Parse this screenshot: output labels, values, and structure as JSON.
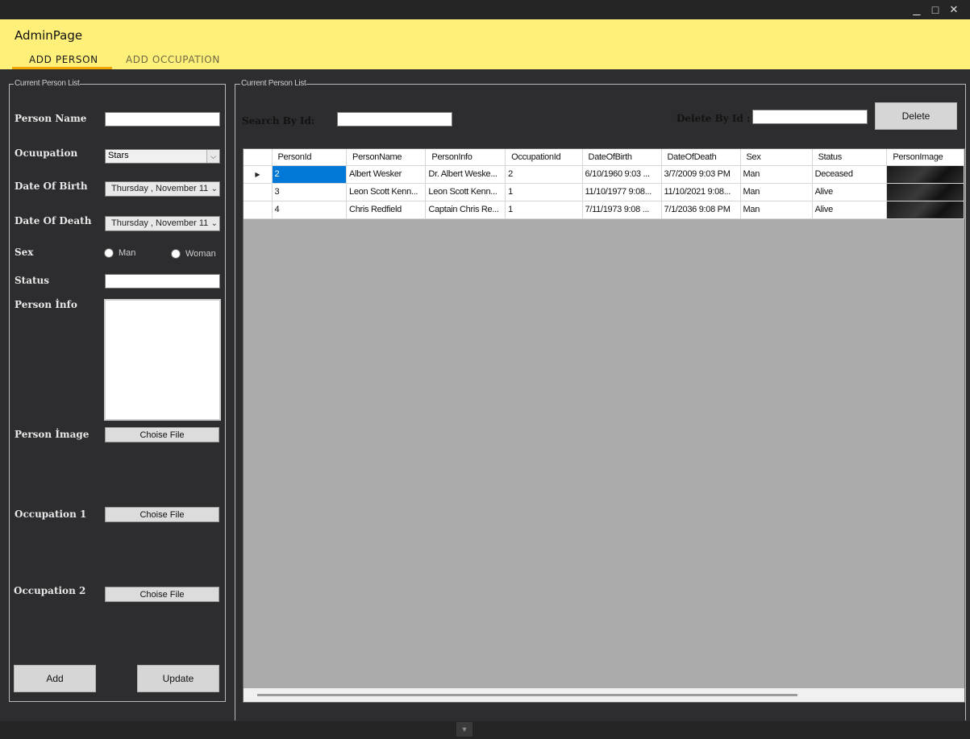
{
  "window": {
    "minimize_glyph": "_",
    "maximize_glyph": "□",
    "close_glyph": "✕"
  },
  "app": {
    "title": "AdminPage",
    "tabs": [
      {
        "label": "ADD PERSON",
        "active": true
      },
      {
        "label": "ADD OCCUPATION",
        "active": false
      }
    ],
    "accent_color": "#fff07a",
    "tab_indicator_color": "#f2a800"
  },
  "form": {
    "group_title": "Current Person List",
    "labels": {
      "person_name": "Person Name",
      "occupation": "Ocuupation",
      "date_of_birth": "Date Of Birth",
      "date_of_death": "Date Of Death",
      "sex": "Sex",
      "status": "Status",
      "person_info": "Person İnfo",
      "person_image": "Person İmage",
      "occupation_1": "Occupation 1",
      "occupation_2": "Occupation 2"
    },
    "values": {
      "person_name": "",
      "occupation": "Stars",
      "date_of_birth": "Thursday  , November 11",
      "date_of_death": "Thursday  , November 11",
      "status": "",
      "person_info": ""
    },
    "sex_options": [
      "Man",
      "Woman"
    ],
    "choose_file_label": "Choise File",
    "add_label": "Add",
    "update_label": "Update"
  },
  "list": {
    "group_title": "Current Person List",
    "search_label": "Search By Id:",
    "search_value": "",
    "delete_label": "Delete By Id :",
    "delete_value": "",
    "delete_button": "Delete",
    "selection_color": "#0078d7",
    "columns": [
      "PersonId",
      "PersonName",
      "PersonInfo",
      "OccupationId",
      "DateOfBirth",
      "DateOfDeath",
      "Sex",
      "Status",
      "PersonImage"
    ],
    "rows": [
      {
        "indicator": "▶",
        "PersonId": "2",
        "PersonName": "Albert Wesker",
        "PersonInfo": "Dr. Albert Weske...",
        "OccupationId": "2",
        "DateOfBirth": "6/10/1960 9:03 ...",
        "DateOfDeath": "3/7/2009 9:03 PM",
        "Sex": "Man",
        "Status": "Deceased"
      },
      {
        "indicator": "",
        "PersonId": "3",
        "PersonName": "Leon Scott Kenn...",
        "PersonInfo": "Leon Scott Kenn...",
        "OccupationId": "1",
        "DateOfBirth": "11/10/1977 9:08...",
        "DateOfDeath": "11/10/2021 9:08...",
        "Sex": "Man",
        "Status": "Alive"
      },
      {
        "indicator": "",
        "PersonId": "4",
        "PersonName": "Chris Redfield",
        "PersonInfo": "Captain Chris Re...",
        "OccupationId": "1",
        "DateOfBirth": "7/11/1973 9:08 ...",
        "DateOfDeath": "7/1/2036 9:08 PM",
        "Sex": "Man",
        "Status": "Alive"
      }
    ]
  },
  "footer": {
    "arrow_glyph": "▼"
  }
}
